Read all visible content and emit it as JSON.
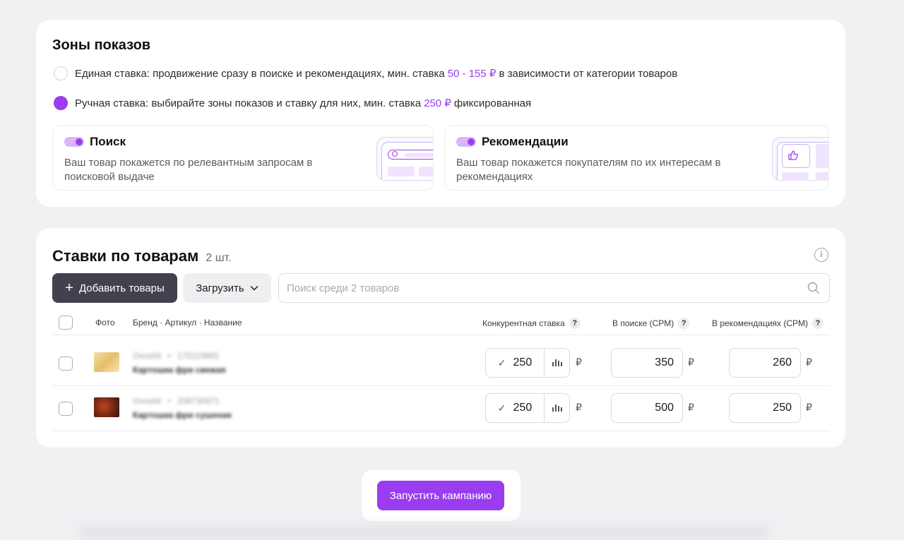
{
  "zones": {
    "title": "Зоны показов",
    "unified": {
      "text": "Единая ставка: продвижение сразу в поиске и рекомендациях, мин. ставка",
      "accent": "50 - 155 ₽",
      "suffix": "в зависимости от категории товаров",
      "selected": false
    },
    "manual": {
      "text": "Ручная ставка: выбирайте зоны показов и ставку для них, мин. ставка",
      "accent": "250 ₽",
      "suffix": "фиксированная",
      "selected": true
    },
    "search": {
      "title": "Поиск",
      "desc": "Ваш товар покажется по релевантным запросам в поисковой выдаче",
      "enabled": true,
      "icon": "search-preview-icon"
    },
    "reco": {
      "title": "Рекомендации",
      "desc": "Ваш товар покажется покупателям по их интересам в рекомендациях",
      "enabled": true,
      "icon": "thumbs-up-preview-icon"
    }
  },
  "bids": {
    "title": "Ставки по товарам",
    "count": "2 шт.",
    "add_label": "Добавить товары",
    "upload_label": "Загрузить",
    "search_placeholder": "Поиск среди 2 товаров",
    "columns": {
      "photo": "Фото",
      "brand": "Бренд · Артикул · Название",
      "competitive": "Конкурентная ставка",
      "search_cpm": "В поиске (CPM)",
      "reco_cpm": "В рекомендациях (CPM)",
      "help": "?"
    },
    "currency": "₽",
    "rows": [
      {
        "brand": "Ovoshil",
        "sep": "•",
        "sku": "170119865",
        "name": "Картошка фри свежая",
        "competitive": "250",
        "search_cpm": "350",
        "reco_cpm": "260"
      },
      {
        "brand": "Ovoshil",
        "sep": "•",
        "sku": "208730871",
        "name": "Картошка фри сушеная",
        "competitive": "250",
        "search_cpm": "500",
        "reco_cpm": "250"
      }
    ]
  },
  "launch_label": "Запустить кампанию",
  "colors": {
    "accent": "#9a3df0",
    "dark_button": "#42424f",
    "background": "#f1f1f4"
  }
}
